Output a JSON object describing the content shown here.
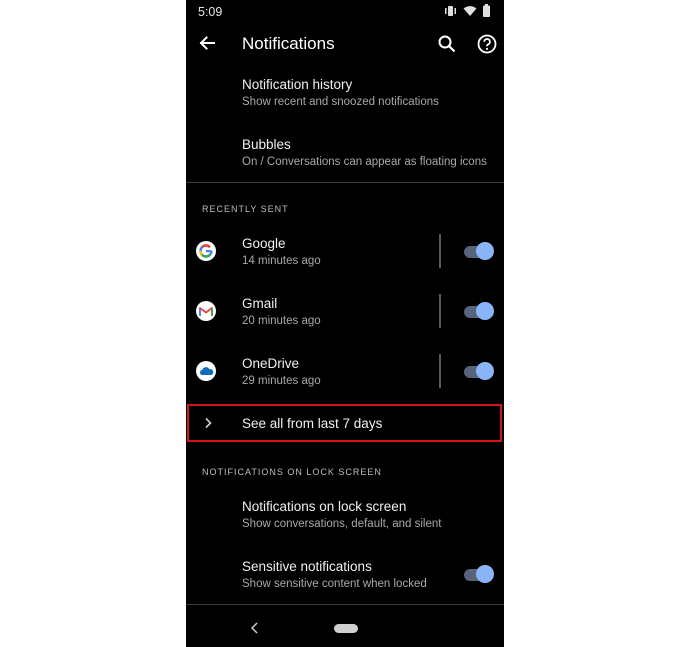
{
  "status_bar": {
    "time": "5:09"
  },
  "app_bar": {
    "title": "Notifications"
  },
  "general": [
    {
      "title": "Notification history",
      "subtitle": "Show recent and snoozed notifications"
    },
    {
      "title": "Bubbles",
      "subtitle": "On / Conversations can appear as floating icons"
    }
  ],
  "recently_sent": {
    "header": "RECENTLY SENT",
    "apps": [
      {
        "name": "Google",
        "time": "14 minutes ago",
        "enabled": true
      },
      {
        "name": "Gmail",
        "time": "20 minutes ago",
        "enabled": true
      },
      {
        "name": "OneDrive",
        "time": "29 minutes ago",
        "enabled": true
      }
    ],
    "see_all_label": "See all from last 7 days"
  },
  "lock_screen": {
    "header": "NOTIFICATIONS ON LOCK SCREEN",
    "items": [
      {
        "title": "Notifications on lock screen",
        "subtitle": "Show conversations, default, and silent"
      },
      {
        "title": "Sensitive notifications",
        "subtitle": "Show sensitive content when locked",
        "enabled": true
      }
    ]
  },
  "colors": {
    "accent": "#8ab4f8",
    "highlight_border": "#d11818",
    "background": "#000000"
  }
}
